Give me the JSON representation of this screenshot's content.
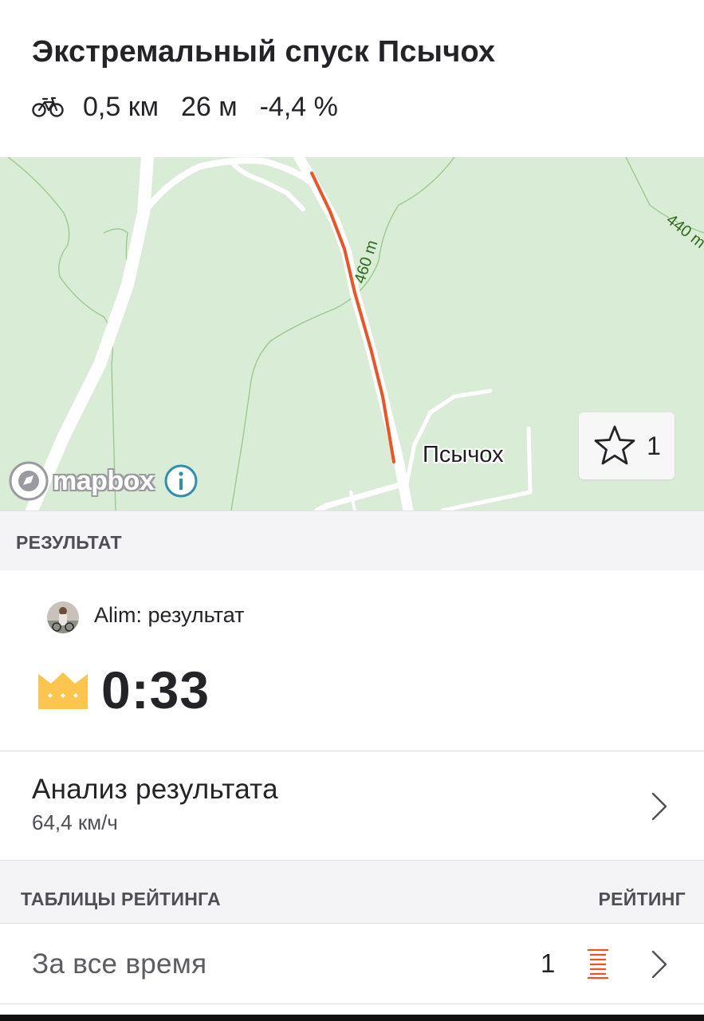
{
  "segment": {
    "title": "Экстремальный спуск Псычох",
    "distance": "0,5 км",
    "elevation": "26 м",
    "grade": "-4,4 %",
    "activity_icon": "bike-icon"
  },
  "map": {
    "place_label": "Псычох",
    "contour_labels": [
      "460 m",
      "440 m"
    ],
    "attribution": "mapbox",
    "star_count": "1",
    "route_color": "#f05222"
  },
  "result_section": {
    "header": "РЕЗУЛЬТАТ",
    "athlete_text": "Alim: результат",
    "time": "0:33",
    "badge_icon": "crown-icon",
    "badge_color": "#fcc64e"
  },
  "analysis": {
    "title": "Анализ результата",
    "subtitle": "64,4 км/ч"
  },
  "leaderboards": {
    "header_left": "ТАБЛИЦЫ РЕЙТИНГА",
    "header_right": "РЕЙТИНГ",
    "rows": [
      {
        "label": "За все время",
        "rank": "1"
      }
    ]
  }
}
